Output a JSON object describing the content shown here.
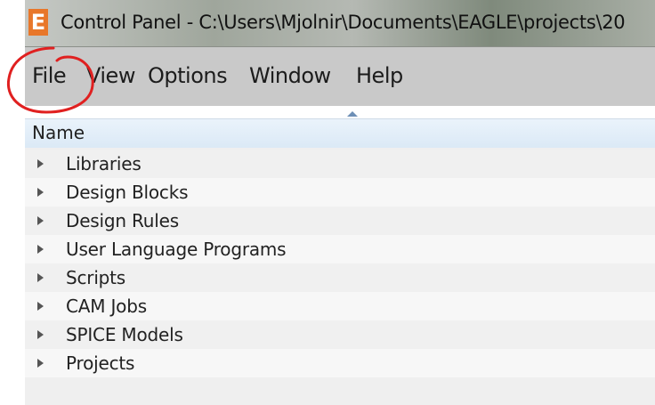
{
  "window": {
    "title": "Control Panel - C:\\Users\\Mjolnir\\Documents\\EAGLE\\projects\\20",
    "app_icon_letter": "E",
    "accent_color": "#e8772a"
  },
  "menu": {
    "items": [
      {
        "label": "File"
      },
      {
        "label": "View"
      },
      {
        "label": "Options"
      },
      {
        "label": "Window"
      },
      {
        "label": "Help"
      }
    ]
  },
  "tree": {
    "column_header": "Name",
    "sort_indicator": "ascending",
    "items": [
      {
        "label": "Libraries",
        "icon": "expand-arrow-icon"
      },
      {
        "label": "Design Blocks",
        "icon": "expand-arrow-icon"
      },
      {
        "label": "Design Rules",
        "icon": "expand-arrow-icon"
      },
      {
        "label": "User Language Programs",
        "icon": "expand-arrow-icon"
      },
      {
        "label": "Scripts",
        "icon": "expand-arrow-icon"
      },
      {
        "label": "CAM Jobs",
        "icon": "expand-arrow-icon"
      },
      {
        "label": "SPICE Models",
        "icon": "expand-arrow-icon"
      },
      {
        "label": "Projects",
        "icon": "expand-arrow-icon"
      }
    ]
  },
  "annotation": {
    "shape": "hand-drawn circle",
    "color": "#e02020",
    "target": "File menu"
  }
}
